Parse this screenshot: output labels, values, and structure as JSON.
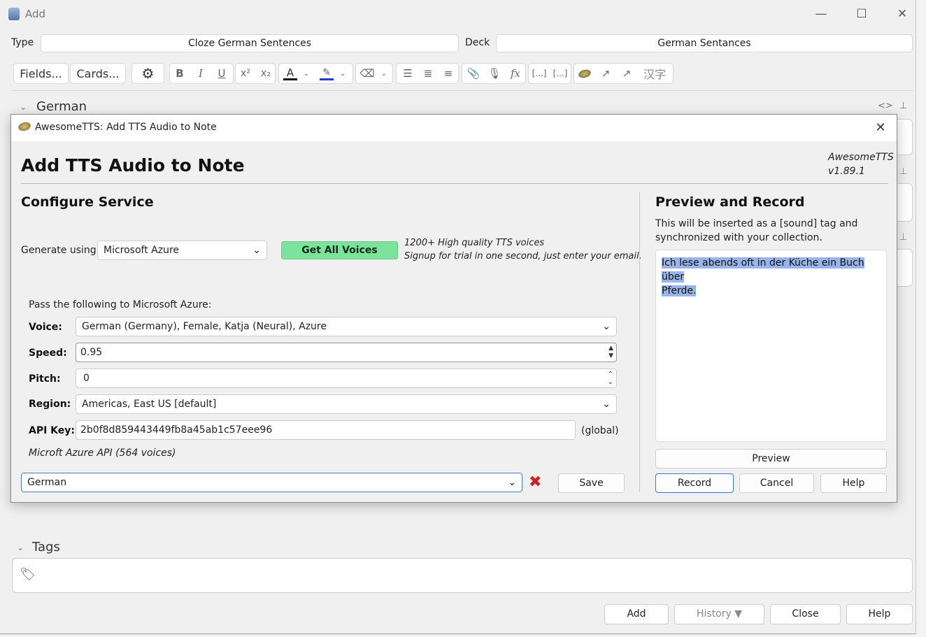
{
  "window": {
    "title": "Add"
  },
  "editor": {
    "type_label": "Type",
    "type_value": "Cloze German Sentences",
    "deck_label": "Deck",
    "deck_value": "German Sentances",
    "fields_button": "Fields...",
    "cards_button": "Cards...",
    "toolbar_icons": [
      "gear-icon",
      "bold-icon",
      "italic-icon",
      "underline-icon",
      "superscript-icon",
      "subscript-icon",
      "text-color-icon",
      "highlight-icon",
      "eraser-icon",
      "bullet-list-icon",
      "numbered-list-icon",
      "align-icon",
      "attach-icon",
      "microphone-icon",
      "formula-icon",
      "cloze-icon",
      "cloze-same-icon",
      "awesometts-icon",
      "link-icon",
      "settings-link-icon",
      "hanzi-icon"
    ],
    "field_german": "German",
    "tags_label": "Tags"
  },
  "footer": {
    "add": "Add",
    "history": "History ▼",
    "close": "Close",
    "help": "Help"
  },
  "dialog": {
    "title": "AwesomeTTS: Add TTS Audio to Note",
    "heading": "Add TTS Audio to Note",
    "version_line1": "AwesomeTTS",
    "version_line2": "v1.89.1",
    "configure_heading": "Configure Service",
    "generate_label": "Generate using",
    "service_value": "Microsoft Azure",
    "get_all_voices": "Get All Voices",
    "promo_line1": "1200+ High quality TTS voices",
    "promo_line2": "Signup for trial in one second, just enter your email.",
    "pass_label": "Pass the following to Microsoft Azure:",
    "voice_label": "Voice:",
    "voice_value": "German (Germany), Female, Katja (Neural), Azure",
    "speed_label": "Speed:",
    "speed_value": "0.95",
    "pitch_label": "Pitch:",
    "pitch_value": "0",
    "region_label": "Region:",
    "region_value": "Americas, East US [default]",
    "apikey_label": "API Key:",
    "apikey_value": "2b0f8d859443449fb8a45ab1c57eee96",
    "apikey_scope": "(global)",
    "api_info": "Microft Azure API (564 voices)",
    "preset_value": "German",
    "save": "Save",
    "preview_heading": "Preview and Record",
    "preview_desc_line1": "This will be inserted as a [sound] tag and",
    "preview_desc_line2": "synchronized with your collection.",
    "preview_text_line1": "Ich lese abends oft in der Küche ein Buch über",
    "preview_text_line2": "Pferde.",
    "preview_button": "Preview",
    "record_button": "Record",
    "cancel_button": "Cancel",
    "help_button": "Help"
  },
  "colors": {
    "accent_green": "#7be39b",
    "selection": "#99b4e8",
    "text_color_bar": "#111111",
    "highlight_bar": "#1a3fc8"
  }
}
